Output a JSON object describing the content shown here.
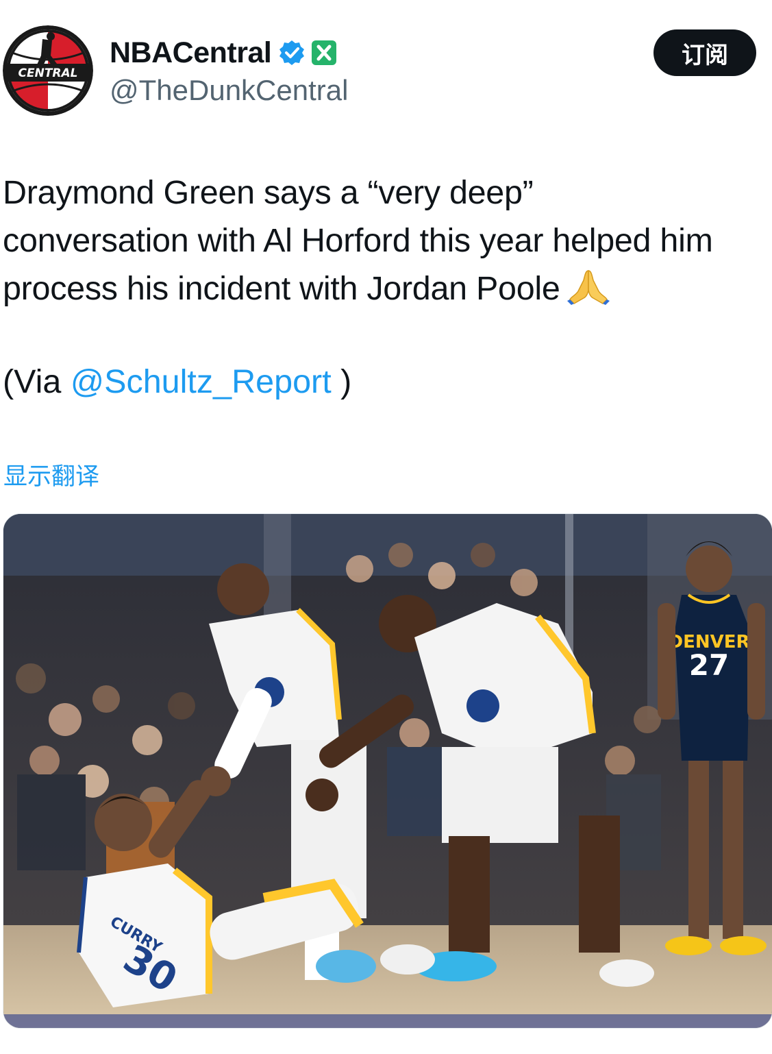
{
  "author": {
    "display_name": "NBACentral",
    "handle": "@TheDunkCentral",
    "avatar_text": "CENTRAL",
    "verified": true,
    "affiliate_badge": "x-badge-icon"
  },
  "subscribe_label": "订阅",
  "tweet": {
    "lines": [
      "Draymond Green says a “very deep”",
      "conversation with Al Horford this year helped him",
      "process his incident with Jordan Poole"
    ],
    "emoji": "folded-hands-icon",
    "via_prefix": "(Via ",
    "mention": "@Schultz_Report",
    "via_suffix": " )"
  },
  "translate_label": "显示翻译",
  "media": {
    "jersey_numbers": {
      "curry": "30",
      "denver": "27"
    },
    "jersey_names": {
      "curry": "CURRY",
      "denver_team": "DENVER"
    }
  },
  "colors": {
    "accent": "#1d9bf0",
    "text": "#0f1419",
    "secondary": "#536471",
    "warriors_blue": "#1d428a",
    "warriors_gold": "#ffc72c",
    "nuggets_navy": "#0e2240"
  }
}
